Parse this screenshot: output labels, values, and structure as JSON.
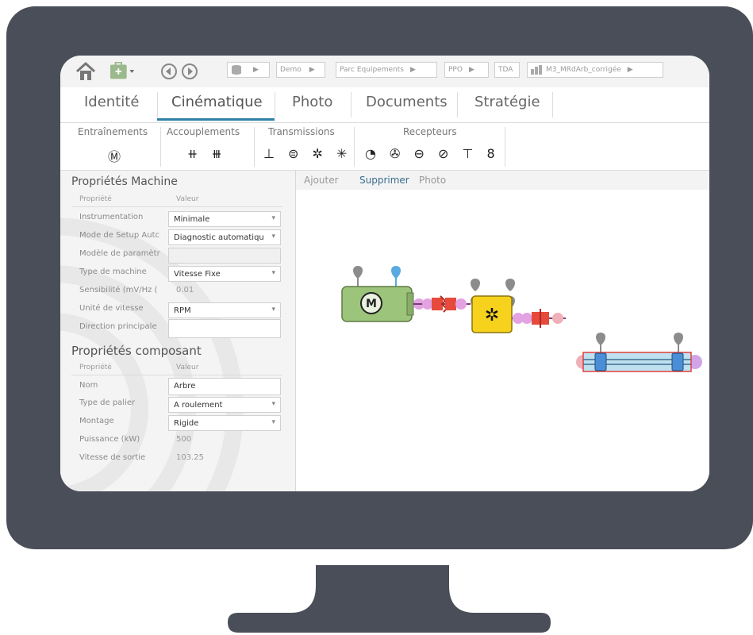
{
  "toolbar": {
    "breadcrumbs": [
      "Demo",
      "Parc Equipements",
      "PPO",
      "TDA",
      "M3_MRdArb_corrigée"
    ]
  },
  "tabs": [
    {
      "label": "Identité",
      "active": false
    },
    {
      "label": "Cinématique",
      "active": true
    },
    {
      "label": "Photo",
      "active": false
    },
    {
      "label": "Documents",
      "active": false
    },
    {
      "label": "Stratégie",
      "active": false
    }
  ],
  "groups": {
    "entrainements": {
      "label": "Entraînements",
      "icons": "Ⓜ"
    },
    "accouplements": {
      "label": "Accouplements",
      "icons": "⧺ ⧻"
    },
    "transmissions": {
      "label": "Transmissions",
      "icons": "⊥ ⊜ ✲ ✳"
    },
    "recepteurs": {
      "label": "Recepteurs",
      "icons": "◔ ✇ ⊖ ⊘ ⊤ 8"
    }
  },
  "machine": {
    "title": "Propriétés Machine",
    "col_prop": "Propriété",
    "col_val": "Valeur",
    "rows": [
      {
        "label": "Instrumentation",
        "value": "Minimale"
      },
      {
        "label": "Mode de Setup Autc",
        "value": "Diagnostic automatiqu"
      },
      {
        "label": "Modèle de paramètr",
        "value": ""
      },
      {
        "label": "Type de machine",
        "value": "Vitesse Fixe"
      },
      {
        "label": "Sensibilité (mV/Hz (",
        "value": "0.01"
      },
      {
        "label": "Unité de vitesse",
        "value": "RPM"
      },
      {
        "label": "Direction principale",
        "value": ""
      }
    ]
  },
  "composant": {
    "title": "Propriétés composant",
    "col_prop": "Propriété",
    "col_val": "Valeur",
    "rows": [
      {
        "label": "Nom",
        "value": "Arbre"
      },
      {
        "label": "Type de palier",
        "value": "A roulement"
      },
      {
        "label": "Montage",
        "value": "Rigide"
      },
      {
        "label": "Puissance (kW)",
        "value": "500"
      },
      {
        "label": "Vitesse de sortie",
        "value": "103.25"
      }
    ]
  },
  "canvas": {
    "actions": {
      "add": "Ajouter",
      "delete": "Supprimer",
      "photo": "Photo"
    },
    "motor_symbol": "M",
    "colors": {
      "motor": "#9cc47a",
      "gearbox": "#f7d21c",
      "coupling": "#e64a3c",
      "shaft": "#bfe0ef",
      "sensor_blue": "#5aa9e0",
      "sensor_gray": "#8c8c8c"
    }
  }
}
